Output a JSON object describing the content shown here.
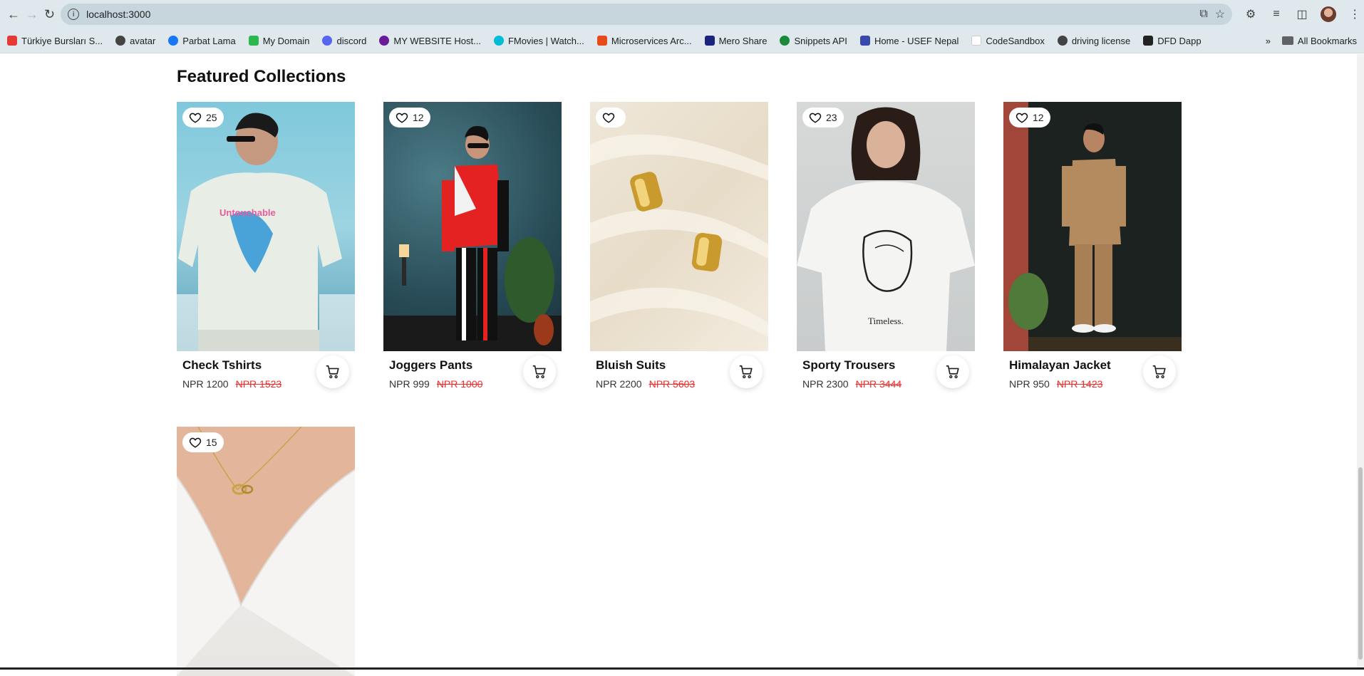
{
  "browser": {
    "url": "localhost:3000",
    "bookmarks": [
      {
        "label": "Türkiye Bursları S...",
        "color": "#e53935"
      },
      {
        "label": "avatar",
        "color": "#444444"
      },
      {
        "label": "Parbat Lama",
        "color": "#1877f2"
      },
      {
        "label": "My Domain",
        "color": "#2db84d"
      },
      {
        "label": "discord",
        "color": "#5865f2"
      },
      {
        "label": "MY WEBSITE Host...",
        "color": "#6a1b9a"
      },
      {
        "label": "FMovies | Watch...",
        "color": "#00bcd4"
      },
      {
        "label": "Microservices Arc...",
        "color": "#e64a19"
      },
      {
        "label": "Mero Share",
        "color": "#1a237e"
      },
      {
        "label": "Snippets API",
        "color": "#1b8a3a"
      },
      {
        "label": "Home - USEF Nepal",
        "color": "#3949ab"
      },
      {
        "label": "CodeSandbox",
        "color": "#dddddd"
      },
      {
        "label": "driving license",
        "color": "#444444"
      },
      {
        "label": "DFD Dapp",
        "color": "#222222"
      }
    ],
    "more_bookmarks": "»",
    "all_bookmarks": "All Bookmarks"
  },
  "section": {
    "title": "Featured Collections"
  },
  "products": [
    {
      "name": "Check Tshirts",
      "likes": "25",
      "price": "NPR 1200",
      "old_price": "NPR 1523"
    },
    {
      "name": "Joggers Pants",
      "likes": "12",
      "price": "NPR 999",
      "old_price": "NPR 1000"
    },
    {
      "name": "Bluish Suits",
      "likes": "",
      "price": "NPR 2200",
      "old_price": "NPR 5603"
    },
    {
      "name": "Sporty Trousers",
      "likes": "23",
      "price": "NPR 2300",
      "old_price": "NPR 3444"
    },
    {
      "name": "Himalayan Jacket",
      "likes": "12",
      "price": "NPR 950",
      "old_price": "NPR 1423"
    },
    {
      "likes": "15"
    }
  ],
  "image_text": {
    "tshirt_print": "Untouchable",
    "tee_print": "Timeless."
  },
  "colors": {
    "old_price": "#ef2b2b",
    "title": "#111111"
  }
}
